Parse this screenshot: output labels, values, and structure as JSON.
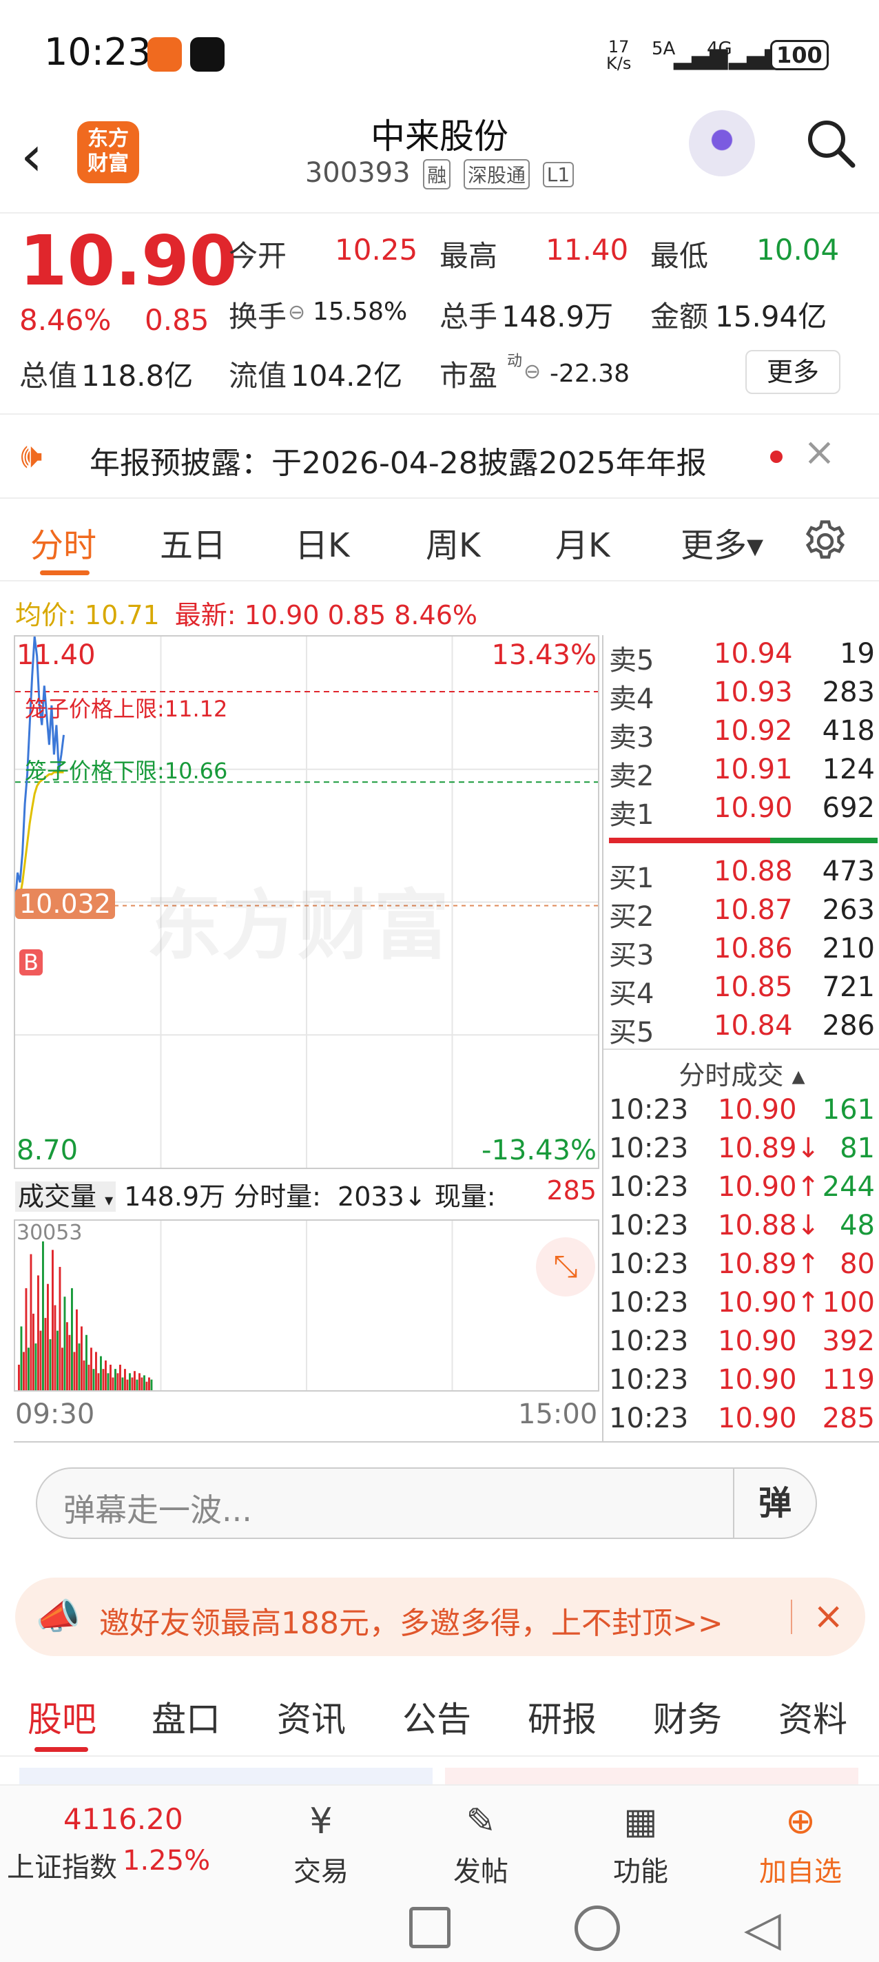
{
  "status": {
    "time": "10:23",
    "net_speed": "17\nK/s",
    "signal1": "5A",
    "signal2": "4G",
    "battery": "100"
  },
  "header": {
    "stock_name": "中来股份",
    "code": "300393",
    "tags": [
      "融",
      "深股通",
      "L1"
    ],
    "logo_text": "东方\n财富"
  },
  "quote": {
    "price": "10.90",
    "change_pct": "8.46%",
    "change": "0.85",
    "open_label": "今开",
    "open": "10.25",
    "high_label": "最高",
    "high": "11.40",
    "low_label": "最低",
    "low": "10.04",
    "turnover_label": "换手",
    "turnover": "15.58%",
    "volume_label": "总手",
    "volume": "148.9万",
    "amount_label": "金额",
    "amount": "15.94亿",
    "mktcap_label": "总值",
    "mktcap": "118.8亿",
    "float_label": "流值",
    "float": "104.2亿",
    "pe_label": "市盈",
    "pe_sup": "动",
    "pe": "-22.38",
    "more_label": "更多"
  },
  "notice": {
    "text": "年报预披露：于2026-04-28披露2025年年报"
  },
  "tabs": [
    "分时",
    "五日",
    "日K",
    "周K",
    "月K",
    "更多▾"
  ],
  "chart_info": {
    "avg_label": "均价:",
    "avg": "10.71",
    "latest_label": "最新:",
    "latest": "10.90 0.85 8.46%"
  },
  "chart_data": {
    "type": "line",
    "y_top": "11.40",
    "y_bottom": "8.70",
    "pct_top": "13.43%",
    "pct_bottom": "-13.43%",
    "upper_limit_label": "笼子价格上限:11.12",
    "lower_limit_label": "笼子价格下限:10.66",
    "ref_price": "10.032",
    "buy_marker": "B",
    "watermark": "东方财富",
    "ylim": [
      8.7,
      11.4
    ],
    "price_series": [
      10.04,
      10.2,
      10.15,
      10.3,
      10.55,
      10.7,
      10.95,
      11.2,
      11.4,
      11.3,
      11.05,
      10.95,
      11.15,
      11.0,
      10.85,
      11.05,
      10.8,
      10.95,
      10.72,
      10.8,
      10.9
    ],
    "avg_series": [
      10.04,
      10.06,
      10.08,
      10.15,
      10.25,
      10.35,
      10.45,
      10.53,
      10.6,
      10.64,
      10.66,
      10.67,
      10.68,
      10.69,
      10.7,
      10.7,
      10.71,
      10.71,
      10.71,
      10.71,
      10.71
    ],
    "x_start": "09:30",
    "x_end": "15:00",
    "volume_max_label": "30053",
    "volumes": [
      12,
      30,
      18,
      48,
      20,
      64,
      36,
      22,
      54,
      28,
      70,
      34,
      50,
      24,
      66,
      40,
      28,
      58,
      20,
      44,
      32,
      26,
      48,
      18,
      38,
      22,
      30,
      14,
      26,
      12,
      20,
      10,
      18,
      8,
      16,
      10,
      14,
      8,
      12,
      6,
      10,
      8,
      12,
      6,
      10,
      5,
      8,
      6,
      9,
      5,
      8,
      6,
      7,
      4,
      6,
      5
    ]
  },
  "volume_info": {
    "select_label": "成交量",
    "total": "148.9万",
    "min_label": "分时量:",
    "min_val": "2033↓",
    "now_label": "现量:",
    "now_val": "285"
  },
  "orderbook": {
    "asks": [
      {
        "l": "卖5",
        "p": "10.94",
        "v": "19"
      },
      {
        "l": "卖4",
        "p": "10.93",
        "v": "283"
      },
      {
        "l": "卖3",
        "p": "10.92",
        "v": "418"
      },
      {
        "l": "卖2",
        "p": "10.91",
        "v": "124"
      },
      {
        "l": "卖1",
        "p": "10.90",
        "v": "692"
      }
    ],
    "bids": [
      {
        "l": "买1",
        "p": "10.88",
        "v": "473"
      },
      {
        "l": "买2",
        "p": "10.87",
        "v": "263"
      },
      {
        "l": "买3",
        "p": "10.86",
        "v": "210"
      },
      {
        "l": "买4",
        "p": "10.85",
        "v": "721"
      },
      {
        "l": "买5",
        "p": "10.84",
        "v": "286"
      }
    ],
    "trades_header": "分时成交 ▴",
    "trades": [
      {
        "t": "10:23",
        "p": "10.90",
        "d": "",
        "v": "161",
        "c": "green"
      },
      {
        "t": "10:23",
        "p": "10.89",
        "d": "↓",
        "v": "81",
        "c": "green"
      },
      {
        "t": "10:23",
        "p": "10.90",
        "d": "↑",
        "v": "244",
        "c": "green"
      },
      {
        "t": "10:23",
        "p": "10.88",
        "d": "↓",
        "v": "48",
        "c": "green"
      },
      {
        "t": "10:23",
        "p": "10.89",
        "d": "↑",
        "v": "80",
        "c": "red"
      },
      {
        "t": "10:23",
        "p": "10.90",
        "d": "↑",
        "v": "100",
        "c": "red"
      },
      {
        "t": "10:23",
        "p": "10.90",
        "d": "",
        "v": "392",
        "c": "red"
      },
      {
        "t": "10:23",
        "p": "10.90",
        "d": "",
        "v": "119",
        "c": "red"
      },
      {
        "t": "10:23",
        "p": "10.90",
        "d": "",
        "v": "285",
        "c": "red"
      }
    ]
  },
  "danmu": {
    "placeholder": "弹幕走一波...",
    "button": "弹"
  },
  "banner": {
    "text": "邀好友领最高188元，多邀多得，上不封顶>>"
  },
  "subtabs": [
    "股吧",
    "盘口",
    "资讯",
    "公告",
    "研报",
    "财务",
    "资料"
  ],
  "bottom_nav": {
    "index_value": "4116.20",
    "index_name": "上证指数",
    "index_change": "1.25%",
    "trade": "交易",
    "post": "发帖",
    "func": "功能",
    "add": "加自选"
  },
  "colors": {
    "red": "#e0262c",
    "green": "#189a3a",
    "orange": "#f06a1f"
  }
}
